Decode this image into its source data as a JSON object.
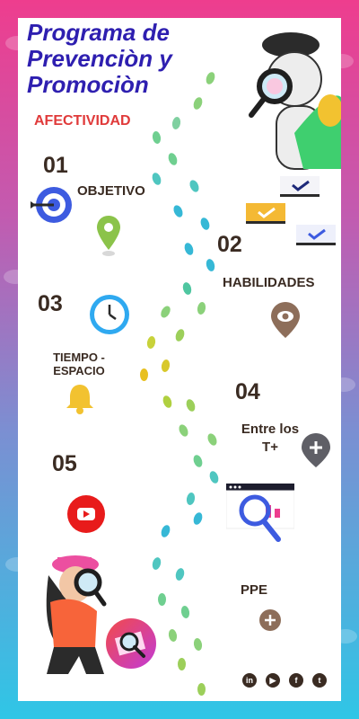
{
  "title": {
    "line1": "Programa de",
    "line2": "Prevenciòn  y",
    "line3": "Promociòn"
  },
  "subtitle": "AFECTIVIDAD",
  "sections": [
    {
      "number": "01",
      "label": "OBJETIVO",
      "icon": "location-pin-icon"
    },
    {
      "number": "02",
      "label": "HABILIDADES",
      "icon": "eye-pin-icon"
    },
    {
      "number": "03",
      "label_line1": "TIEMPO -",
      "label_line2": "ESPACIO",
      "icon": "clock-icon"
    },
    {
      "number": "04",
      "label_line1": "Entre los",
      "label_line2": "T+",
      "icon": "plus-pin-icon"
    },
    {
      "number": "05",
      "icon": "youtube-icon"
    },
    {
      "label": "PPE",
      "icon": "plus-circle-icon"
    }
  ],
  "social": [
    {
      "name": "linkedin-icon",
      "glyph": "in"
    },
    {
      "name": "youtube-icon",
      "glyph": "▶"
    },
    {
      "name": "facebook-icon",
      "glyph": "f"
    },
    {
      "name": "twitter-icon",
      "glyph": "t"
    }
  ],
  "colors": {
    "title": "#2e1fb0",
    "subtitle": "#e03a3a",
    "text": "#3a2b22",
    "target": "#3d5be0",
    "pin_green": "#8bc34a",
    "pin_brown": "#8d6e5a",
    "pin_gray": "#5f5f66",
    "bell": "#f2c230",
    "youtube": "#e81b1b"
  }
}
